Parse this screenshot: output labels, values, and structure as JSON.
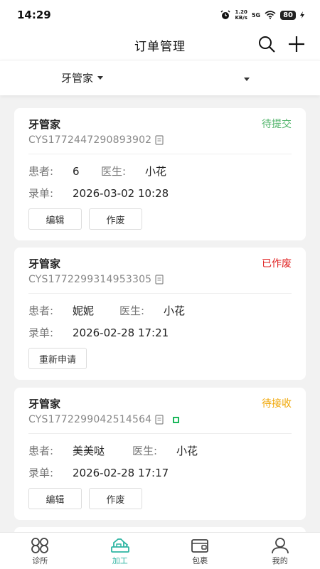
{
  "status_bar": {
    "time": "14:29",
    "net_speed_top": "1.20",
    "net_speed_bottom": "KB/s",
    "signal": "5G",
    "battery": "80"
  },
  "header": {
    "title": "订单管理"
  },
  "filters": {
    "left_label": "牙管家",
    "right_label": ""
  },
  "orders": [
    {
      "title": "牙管家",
      "status": "待提交",
      "status_color": "#52b46b",
      "code": "CYS1772447290893902",
      "patient_label": "患者:",
      "patient": "6",
      "doctor_label": "医生:",
      "doctor": "小花",
      "date_label": "录单:",
      "date": "2026-03-02 10:28",
      "buttons": [
        "编辑",
        "作废"
      ]
    },
    {
      "title": "牙管家",
      "status": "已作废",
      "status_color": "#e02020",
      "code": "CYS1772299314953305",
      "patient_label": "患者:",
      "patient": "妮妮",
      "doctor_label": "医生:",
      "doctor": "小花",
      "date_label": "录单:",
      "date": "2026-02-28 17:21",
      "buttons": [
        "重新申请"
      ]
    },
    {
      "title": "牙管家",
      "status": "待接收",
      "status_color": "#f0a500",
      "code": "CYS1772299042514564",
      "patient_label": "患者:",
      "patient": "美美哒",
      "doctor_label": "医生:",
      "doctor": "小花",
      "date_label": "录单:",
      "date": "2026-02-28 17:17",
      "buttons": [
        "编辑",
        "作废"
      ]
    }
  ],
  "tab_bar": {
    "items": [
      {
        "label": "诊所",
        "icon": "clinic-icon"
      },
      {
        "label": "加工",
        "icon": "processing-icon",
        "active": true
      },
      {
        "label": "包裹",
        "icon": "package-icon"
      },
      {
        "label": "我的",
        "icon": "profile-icon"
      }
    ],
    "active_color": "#2fb5a3"
  }
}
